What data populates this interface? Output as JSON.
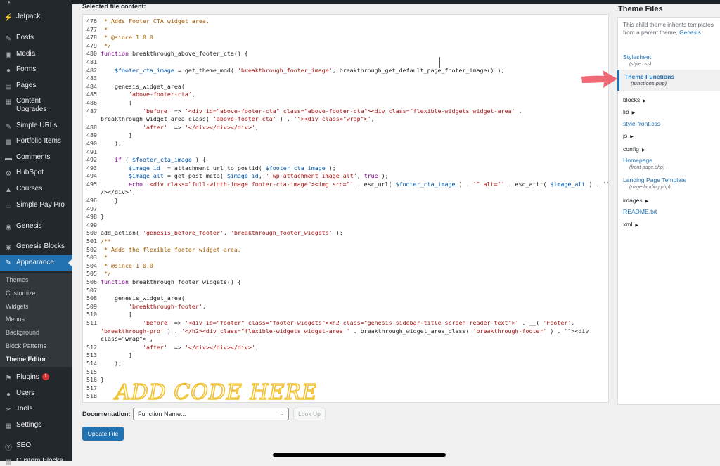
{
  "sidebar": {
    "items": [
      {
        "label": "Jetpack",
        "icon": "jetpack-icon"
      },
      {
        "label": "Posts",
        "icon": "pin-icon"
      },
      {
        "label": "Media",
        "icon": "media-icon"
      },
      {
        "label": "Forms",
        "icon": "forms-icon"
      },
      {
        "label": "Pages",
        "icon": "pages-icon"
      },
      {
        "label": "Content Upgrades",
        "icon": "content-upgrades-icon"
      },
      {
        "label": "Simple URLs",
        "icon": "pin-icon"
      },
      {
        "label": "Portfolio Items",
        "icon": "portfolio-icon"
      },
      {
        "label": "Comments",
        "icon": "comments-icon"
      },
      {
        "label": "HubSpot",
        "icon": "hubspot-icon"
      },
      {
        "label": "Courses",
        "icon": "courses-icon"
      },
      {
        "label": "Simple Pay Pro",
        "icon": "simple-pay-icon"
      },
      {
        "label": "Genesis",
        "icon": "genesis-icon"
      },
      {
        "label": "Genesis Blocks",
        "icon": "genesis-blocks-icon"
      },
      {
        "label": "Appearance",
        "icon": "appearance-icon"
      }
    ],
    "submenu": [
      "Themes",
      "Customize",
      "Widgets",
      "Menus",
      "Background",
      "Block Patterns",
      "Theme Editor"
    ],
    "items_after": [
      {
        "label": "Plugins",
        "icon": "plugins-icon",
        "badge": "1"
      },
      {
        "label": "Users",
        "icon": "users-icon"
      },
      {
        "label": "Tools",
        "icon": "tools-icon"
      },
      {
        "label": "Settings",
        "icon": "settings-icon"
      },
      {
        "label": "SEO",
        "icon": "seo-icon"
      },
      {
        "label": "Custom Blocks",
        "icon": "custom-blocks-icon"
      }
    ]
  },
  "main": {
    "selected_label": "Selected file content:",
    "code_lines": [
      {
        "n": "476",
        "text": " * Adds Footer CTA widget area."
      },
      {
        "n": "477",
        "text": " *"
      },
      {
        "n": "478",
        "text": " * @since 1.0.0"
      },
      {
        "n": "479",
        "text": " */"
      },
      {
        "n": "480",
        "text": "function breakthrough_above_footer_cta() {"
      },
      {
        "n": "481",
        "text": ""
      },
      {
        "n": "482",
        "text": "    $footer_cta_image = get_theme_mod( 'breakthrough_footer_image', breakthrough_get_default_page_footer_image() );"
      },
      {
        "n": "483",
        "text": ""
      },
      {
        "n": "484",
        "text": "    genesis_widget_area("
      },
      {
        "n": "485",
        "text": "        'above-footer-cta',"
      },
      {
        "n": "486",
        "text": "        ["
      },
      {
        "n": "487",
        "text": "            'before' => '<div id=\"above-footer-cta\" class=\"above-footer-cta\"><div class=\"flexible-widgets widget-area' ."
      },
      {
        "n": "",
        "text": "breakthrough_widget_area_class( 'above-footer-cta' ) . '\"><div class=\"wrap\">',"
      },
      {
        "n": "488",
        "text": "            'after'  => '</div></div></div>',"
      },
      {
        "n": "489",
        "text": "        ]"
      },
      {
        "n": "490",
        "text": "    );"
      },
      {
        "n": "491",
        "text": ""
      },
      {
        "n": "492",
        "text": "    if ( $footer_cta_image ) {"
      },
      {
        "n": "493",
        "text": "        $image_id  = attachment_url_to_postid( $footer_cta_image );"
      },
      {
        "n": "494",
        "text": "        $image_alt = get_post_meta( $image_id, '_wp_attachment_image_alt', true );"
      },
      {
        "n": "495",
        "text": "        echo '<div class=\"full-width-image footer-cta-image\"><img src=\"' . esc_url( $footer_cta_image ) . '\" alt=\"' . esc_attr( $image_alt ) . '\""
      },
      {
        "n": "",
        "text": "/></div>';"
      },
      {
        "n": "496",
        "text": "    }"
      },
      {
        "n": "497",
        "text": ""
      },
      {
        "n": "498",
        "text": "}"
      },
      {
        "n": "499",
        "text": ""
      },
      {
        "n": "500",
        "text": "add_action( 'genesis_before_footer', 'breakthrough_footer_widgets' );"
      },
      {
        "n": "501",
        "text": "/**"
      },
      {
        "n": "502",
        "text": " * Adds the flexible footer widget area."
      },
      {
        "n": "503",
        "text": " *"
      },
      {
        "n": "504",
        "text": " * @since 1.0.0"
      },
      {
        "n": "505",
        "text": " */"
      },
      {
        "n": "506",
        "text": "function breakthrough_footer_widgets() {"
      },
      {
        "n": "507",
        "text": ""
      },
      {
        "n": "508",
        "text": "    genesis_widget_area("
      },
      {
        "n": "509",
        "text": "        'breakthrough-footer',"
      },
      {
        "n": "510",
        "text": "        ["
      },
      {
        "n": "511",
        "text": "            'before' => '<div id=\"footer\" class=\"footer-widgets\"><h2 class=\"genesis-sidebar-title screen-reader-text\">' . __( 'Footer',"
      },
      {
        "n": "",
        "text": "'breakthrough-pro' ) . '</h2><div class=\"flexible-widgets widget-area ' . breakthrough_widget_area_class( 'breakthrough-footer' ) . '\"><div"
      },
      {
        "n": "",
        "text": "class=\"wrap\">',"
      },
      {
        "n": "512",
        "text": "            'after'  => '</div></div></div>',"
      },
      {
        "n": "513",
        "text": "        ]"
      },
      {
        "n": "514",
        "text": "    );"
      },
      {
        "n": "515",
        "text": ""
      },
      {
        "n": "516",
        "text": "}"
      },
      {
        "n": "517",
        "text": ""
      },
      {
        "n": "518",
        "text": ""
      }
    ],
    "handwriting": "ADD CODE HERE",
    "documentation_label": "Documentation:",
    "doc_select_value": "Function Name...",
    "lookup_label": "Look Up",
    "update_label": "Update File"
  },
  "files_panel": {
    "title": "Theme Files",
    "desc_text": "This child theme inherits templates from a parent theme,",
    "desc_link": "Genesis",
    "files": [
      {
        "name": "Stylesheet",
        "sub": "(style.css)"
      },
      {
        "name": "Theme Functions",
        "sub": "(functions.php)"
      },
      {
        "name": "blocks",
        "dir": true
      },
      {
        "name": "lib",
        "dir": true
      },
      {
        "name": "style-front.css"
      },
      {
        "name": "js",
        "dir": true
      },
      {
        "name": "config",
        "dir": true
      },
      {
        "name": "Homepage",
        "sub": "(front-page.php)"
      },
      {
        "name": "Landing Page Template",
        "sub": "(page-landing.php)"
      },
      {
        "name": "images",
        "dir": true
      },
      {
        "name": "README.txt"
      },
      {
        "name": "xml",
        "dir": true
      }
    ]
  },
  "colors": {
    "sidebar_bg": "#23282d",
    "accent": "#2271b1",
    "highlight_yellow": "#f2c230",
    "arrow_red": "#ef4d5e"
  }
}
